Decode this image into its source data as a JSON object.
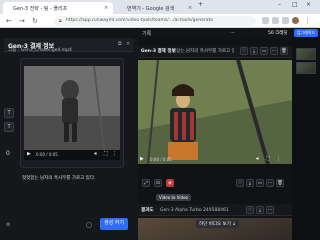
{
  "browser": {
    "tabs": [
      {
        "label": "Gen-3 전략 - 팀 - 플리프"
      },
      {
        "label": "번역기 - Google 검색"
      }
    ],
    "url": "https://app.runwayml.com/video-tools/teams/.../ai-tools/generate",
    "new_tab": "+",
    "min": "–",
    "max": "□",
    "close": "×"
  },
  "left": {
    "title": "Gen-3 결제 정보",
    "filename": "크롭 - Gen3_Challenge4.mp4",
    "caption": "영상 내에 피사체가 있습니다.",
    "caption2": "헛헛함는 남자의 흑사무를 가로고 있다.",
    "button": "생성 하기",
    "side_letters": [
      "T",
      "T",
      "0"
    ],
    "size_badge": "0"
  },
  "right": {
    "header": {
      "label": "기록",
      "right_icons": "⋯",
      "credits": "50 크레딧",
      "upgrade": "업그레이드"
    },
    "clip1": {
      "badge": "Gen-3 결제 정보",
      "desc": "영상는 남자의 흑사무를 가로고 있다. | Gen-3 Alpha Turbo",
      "time": "0:00 / 0:05"
    },
    "clip2": {
      "badge": "결과도",
      "desc": "Gen-3 Alpha Turbo 249588461 영상는 남자는..."
    },
    "tooltip": "Video to Video",
    "tail_label": "하단 비디오 보기 ↓"
  },
  "colors": {
    "accent": "#2f6df0",
    "bg_dark": "#15171b"
  }
}
